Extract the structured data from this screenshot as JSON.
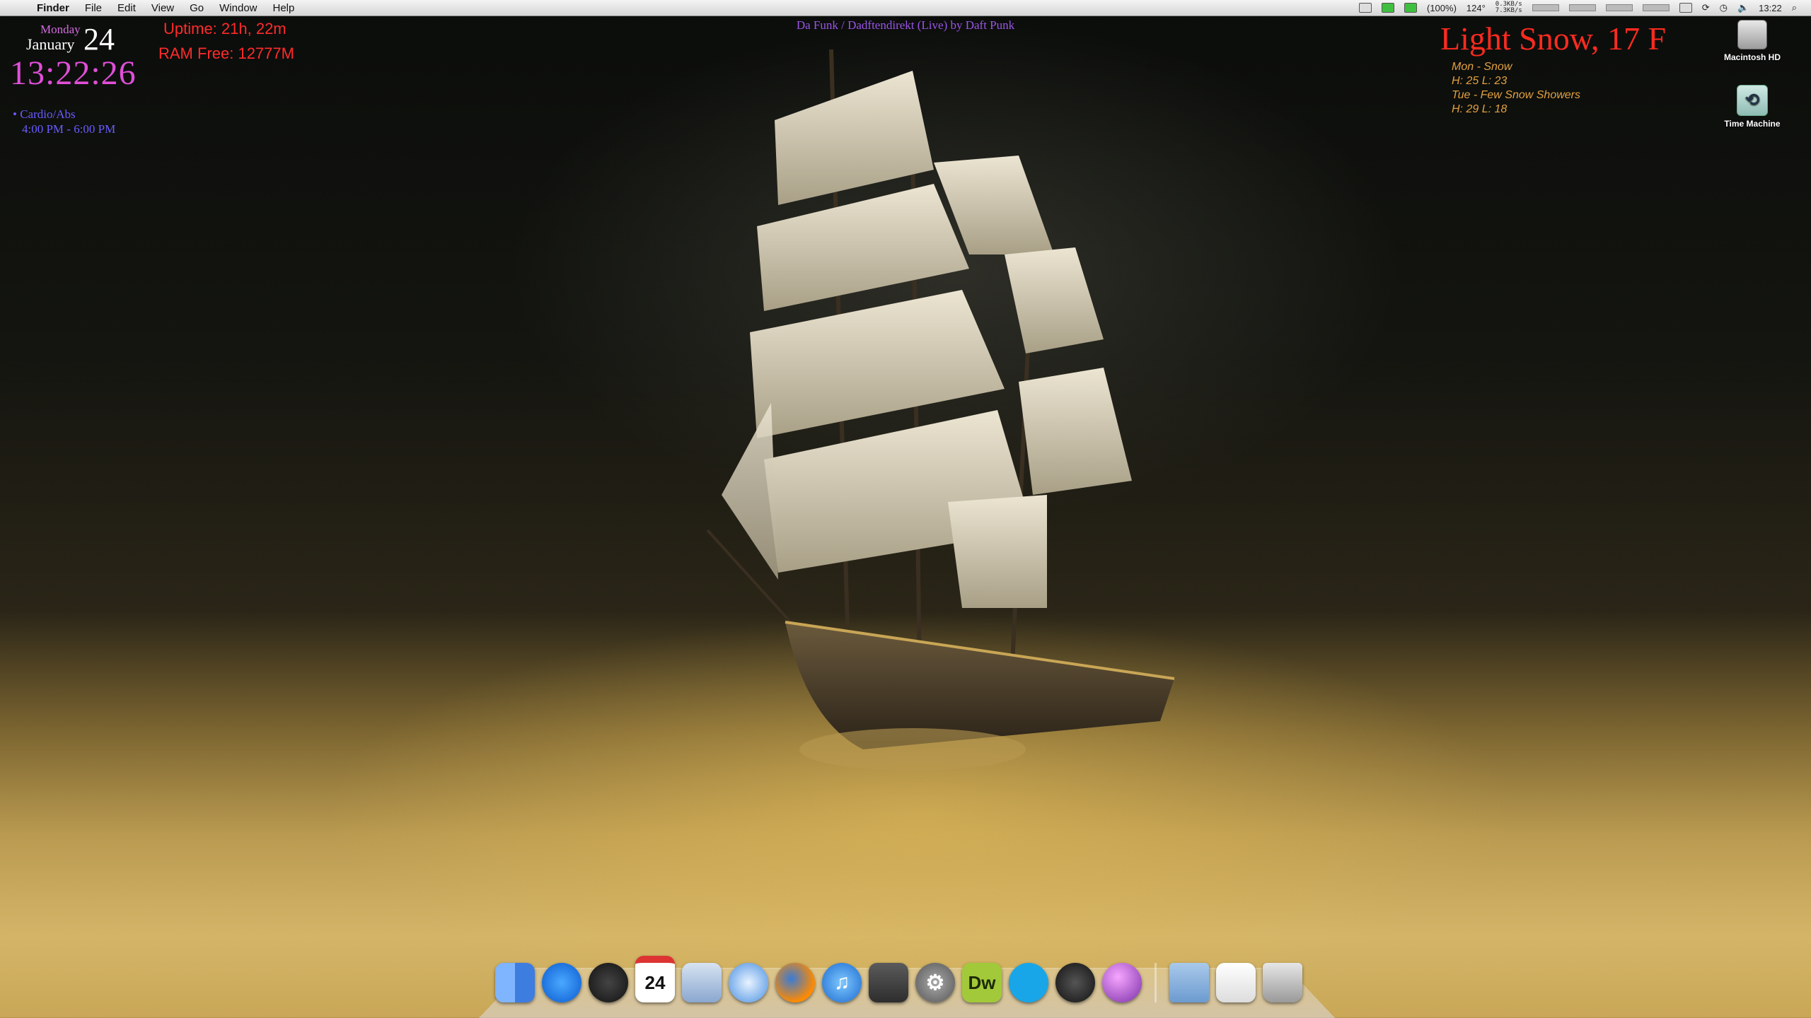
{
  "menubar": {
    "app": "Finder",
    "items": [
      "File",
      "Edit",
      "View",
      "Go",
      "Window",
      "Help"
    ],
    "status": {
      "battery": "(100%)",
      "temperature": "124°",
      "net_down": "0.3KB/s",
      "net_up": "7.3KB/s",
      "time": "13:22"
    }
  },
  "widgets": {
    "day_name": "Monday",
    "month": "January",
    "day_number": "24",
    "clock": "13:22:26",
    "event": {
      "title": "• Cardio/Abs",
      "time": "4:00 PM - 6:00 PM"
    },
    "uptime": "Uptime: 21h, 22m",
    "ram_free": "RAM Free: 12777M",
    "now_playing": "Da Funk / Dadftendirekt (Live) by Daft Punk",
    "weather": {
      "current": "Light Snow, 17 F",
      "forecast": [
        {
          "day_line": "Mon - Snow",
          "temps": "H: 25  L: 23"
        },
        {
          "day_line": "Tue - Few Snow Showers",
          "temps": "H: 29  L: 18"
        }
      ]
    }
  },
  "desktop_icons": [
    {
      "label": "Macintosh HD"
    },
    {
      "label": "Time Machine"
    }
  ],
  "dock": {
    "ical_day": "24",
    "dw_label": "Dw"
  }
}
